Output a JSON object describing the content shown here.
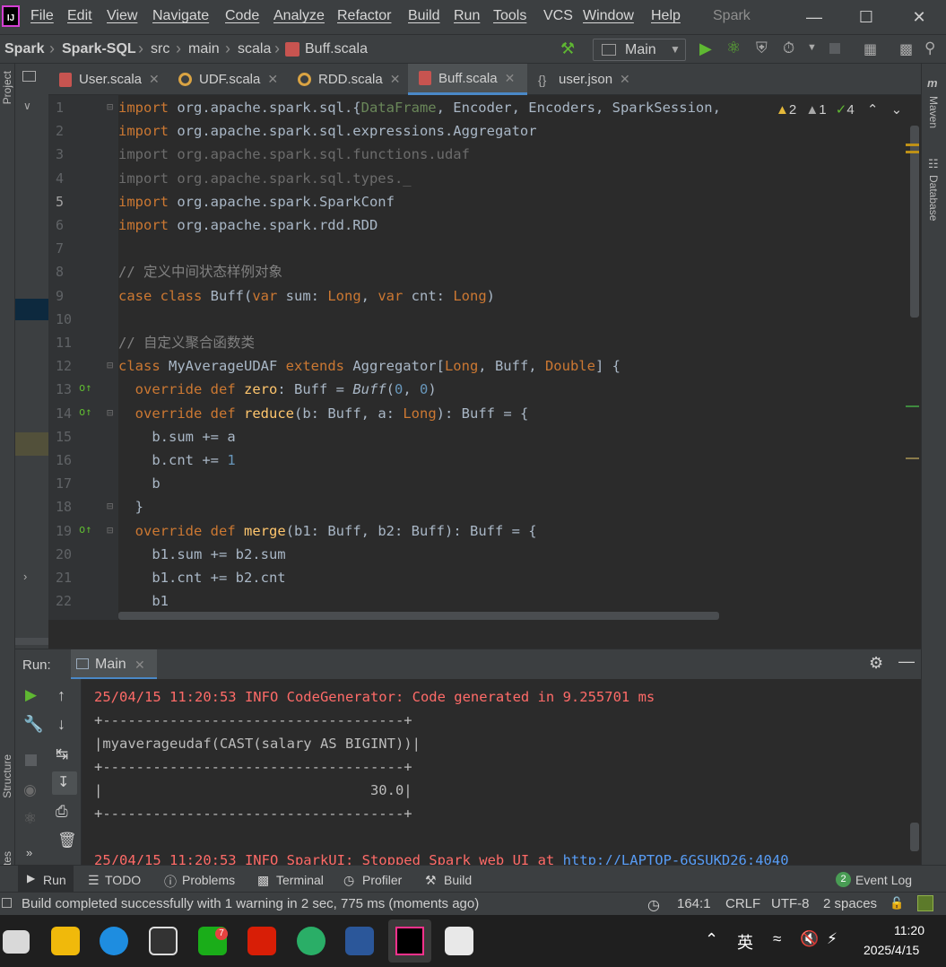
{
  "menu": {
    "items": [
      "File",
      "Edit",
      "View",
      "Navigate",
      "Code",
      "Analyze",
      "Refactor",
      "Build",
      "Run",
      "Tools",
      "VCS",
      "Window",
      "Help"
    ],
    "window_title": "Spark"
  },
  "navbar": {
    "crumbs": [
      "Spark",
      "Spark-SQL",
      "src",
      "main",
      "scala",
      "Buff.scala"
    ],
    "run_config": "Main"
  },
  "tabs": [
    {
      "label": "User.scala",
      "icon": "scala-file-icon"
    },
    {
      "label": "UDF.scala",
      "icon": "scala-object-icon"
    },
    {
      "label": "RDD.scala",
      "icon": "scala-object-icon"
    },
    {
      "label": "Buff.scala",
      "icon": "scala-file-icon",
      "active": true
    },
    {
      "label": "user.json",
      "icon": "json-file-icon"
    }
  ],
  "inspections": {
    "warnings": "2",
    "weak_warnings": "1",
    "typos": "4"
  },
  "side_tools": {
    "left_top": "Project",
    "right_top": "Maven",
    "right_db": "Database",
    "left_structure": "Structure",
    "left_favorites": "Favorites"
  },
  "editor": {
    "line_numbers": [
      "1",
      "2",
      "3",
      "4",
      "5",
      "6",
      "7",
      "8",
      "9",
      "10",
      "11",
      "12",
      "13",
      "14",
      "15",
      "16",
      "17",
      "18",
      "19",
      "20",
      "21",
      "22"
    ],
    "lines": [
      "import org.apache.spark.sql.{DataFrame, Encoder, Encoders, SparkSession, ",
      "import org.apache.spark.sql.expressions.Aggregator",
      "import org.apache.spark.sql.functions.udaf",
      "import org.apache.spark.sql.types._",
      "import org.apache.spark.SparkConf",
      "import org.apache.spark.rdd.RDD",
      "",
      "// 定义中间状态样例对象",
      "case class Buff(var sum: Long, var cnt: Long)",
      "",
      "// 自定义聚合函数类",
      "class MyAverageUDAF extends Aggregator[Long, Buff, Double] {",
      "  override def zero: Buff = Buff(0, 0)",
      "  override def reduce(b: Buff, a: Long): Buff = {",
      "    b.sum += a",
      "    b.cnt += 1",
      "    b",
      "  }",
      "  override def merge(b1: Buff, b2: Buff): Buff = {",
      "    b1.sum += b2.sum",
      "    b1.cnt += b2.cnt",
      "    b1"
    ]
  },
  "run_panel": {
    "label": "Run:",
    "tab": "Main",
    "output": [
      "25/04/15 11:20:53 INFO CodeGenerator: Code generated in 9.255701 ms",
      "+------------------------------------+",
      "|myaverageudaf(CAST(salary AS BIGINT))|",
      "+------------------------------------+",
      "|                                30.0|",
      "+------------------------------------+",
      "",
      "25/04/15 11:20:53 INFO SparkUI: Stopped Spark web UI at "
    ],
    "link": "http://LAPTOP-6GSUKD26:4040"
  },
  "bottom_tools": [
    "Run",
    "TODO",
    "Problems",
    "Terminal",
    "Profiler",
    "Build"
  ],
  "event_log": {
    "count": "2",
    "label": "Event Log"
  },
  "status": {
    "message": "Build completed successfully with 1 warning in 2 sec, 775 ms (moments ago)",
    "position": "164:1",
    "line_sep": "CRLF",
    "encoding": "UTF-8",
    "indent": "2 spaces"
  },
  "taskbar": {
    "ime": "英",
    "time": "11:20",
    "date": "2025/4/15",
    "wechat_badge": "7"
  },
  "colors": {
    "keyword": "#cc7832",
    "string": "#6a8759",
    "number": "#6897bb",
    "comment": "#808080",
    "function": "#ffc66d",
    "error_text": "#ff6b68",
    "link": "#589df6"
  }
}
